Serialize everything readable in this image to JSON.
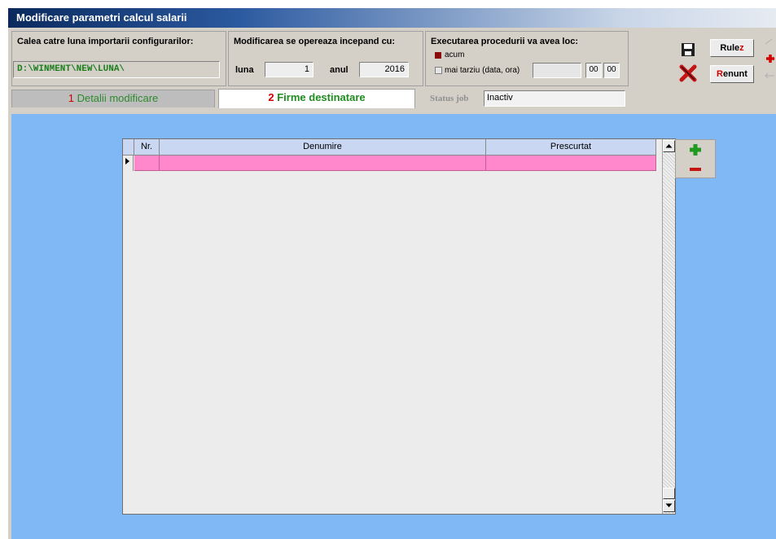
{
  "window": {
    "title": "Modificare parametri calcul salarii"
  },
  "import_path": {
    "label": "Calea catre luna importarii configurarilor:",
    "value": "D:\\WINMENT\\NEW\\LUNA\\"
  },
  "start": {
    "label": "Modificarea se opereaza incepand cu:",
    "month_label": "luna",
    "month_value": "1",
    "year_label": "anul",
    "year_value": "2016"
  },
  "execution": {
    "label": "Executarea procedurii va avea loc:",
    "option_now": "acum",
    "option_later": "mai tarziu (data, ora)",
    "hour": "00",
    "minute": "00"
  },
  "buttons": {
    "run_main": "Rule",
    "run_hot": "z",
    "cancel_hot": "R",
    "cancel_main": "enunt"
  },
  "tabs": [
    {
      "num": "1",
      "label": "Detalii modificare"
    },
    {
      "num": "2",
      "label": "Firme destinatare"
    }
  ],
  "status": {
    "label": "Status job",
    "value": "Inactiv"
  },
  "grid": {
    "columns": [
      "Nr.",
      "Denumire",
      "Prescurtat"
    ],
    "rows": [
      {
        "nr": "",
        "denumire": "",
        "prescurtat": ""
      }
    ]
  },
  "colors": {
    "accent_blue": "#7fb8f5",
    "row_highlight": "#ff88cc",
    "title_dark": "#0a2a5e",
    "tab_green": "#1e8c1e",
    "hotkey_red": "#d40000"
  },
  "icons": [
    "save-icon",
    "cancel-x-icon",
    "add-icon",
    "remove-icon",
    "scroll-up-icon",
    "scroll-down-icon",
    "row-pointer-icon"
  ]
}
